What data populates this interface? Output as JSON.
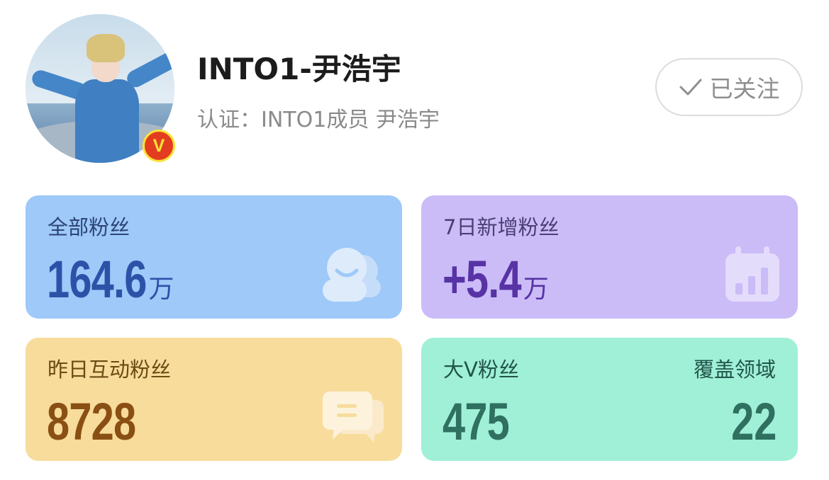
{
  "profile": {
    "name": "INTO1-尹浩宇",
    "verification": "认证：INTO1成员 尹浩宇",
    "badge": "V",
    "follow_button": "已关注"
  },
  "stats": {
    "total_fans": {
      "label": "全部粉丝",
      "value": "164.6",
      "unit": "万"
    },
    "new_fans_7d": {
      "label": "7日新增粉丝",
      "value": "+5.4",
      "unit": "万"
    },
    "active_fans_yesterday": {
      "label": "昨日互动粉丝",
      "value": "8728"
    },
    "big_v_fans": {
      "label": "大V粉丝",
      "value": "475",
      "domain_label": "覆盖领域",
      "domain_value": "22"
    }
  },
  "colors": {
    "card_blue": "#9ec9f9",
    "card_purple": "#cbbcf8",
    "card_yellow": "#f7dc9b",
    "card_green": "#9ff0d6",
    "badge_red": "#e33d1f",
    "badge_yellow": "#f8e43a"
  },
  "icons": {
    "card1": "fans-group-icon",
    "card2": "bar-chart-calendar-icon",
    "card3": "chat-bubble-icon",
    "follow": "check-icon"
  }
}
